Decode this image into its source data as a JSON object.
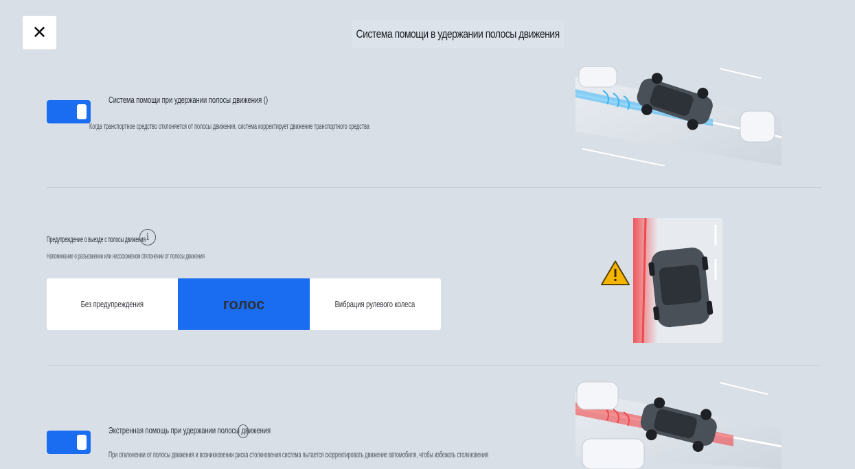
{
  "header": {
    "close_icon": "close-icon",
    "close_glyph": "✕",
    "title": "Система помощи в удержании полосы движения"
  },
  "lane_keep": {
    "enabled": true,
    "title": "Система помощи при удержании полосы движения ()",
    "description": "Когда транспортное средство отклоняется от полосы движения, система корректирует движение транспортного средства"
  },
  "departure_warning": {
    "title": "Предупреждение о выезде с полосы движения",
    "info_glyph": "i",
    "description": "Напоминание о разъезжении или несоскоменом отклонении от полосы движения",
    "options": [
      {
        "label": "Без предупреждения",
        "selected": false
      },
      {
        "label": "голос",
        "selected": true
      },
      {
        "label": "Вибрация рулевого колеса",
        "selected": false
      }
    ]
  },
  "emergency": {
    "enabled": true,
    "title": "Экстренная помощь при удержании полосы движения",
    "description": "При отклонении от полосы движения и возникновении риска столкновения система пытается скорректировать движение автомобиля, чтобы избежать столкновения"
  },
  "colors": {
    "accent": "#1a6cf0",
    "background": "#d9dfe7",
    "warning": "#f5b400",
    "lane_blue": "#3ab4f5",
    "lane_red": "#f0484b"
  }
}
